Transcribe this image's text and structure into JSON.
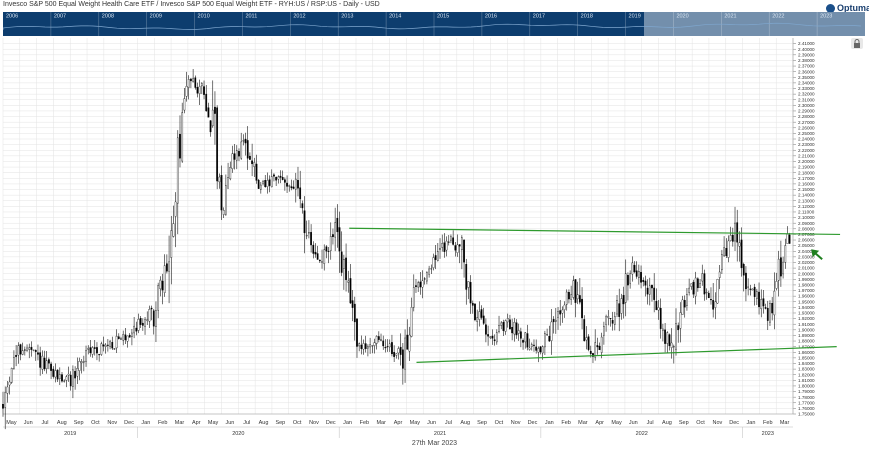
{
  "header": {
    "title": "Invesco S&P 500 Equal Weight Health Care ETF / Invesco S&P 500 Equal Weight ETF - RYH:US / RSP:US - Daily - USD",
    "logo_text": "Optuma"
  },
  "navigator": {
    "years": [
      "2006",
      "2007",
      "2008",
      "2009",
      "2010",
      "2011",
      "2012",
      "2013",
      "2014",
      "2015",
      "2016",
      "2017",
      "2018",
      "2019",
      "2020",
      "2021",
      "2022",
      "2023"
    ],
    "background": "#0d3d6e",
    "highlight": "#c8d4e0"
  },
  "footer": {
    "date_caption": "27th Mar 2023"
  },
  "colors": {
    "candle": "#000000",
    "trendline": "#2e9a2e",
    "arrow": "#1f7f1f",
    "grid": "#e3e3e3"
  },
  "chart_data": {
    "type": "candlestick",
    "title": "Invesco S&P 500 Equal Weight Health Care ETF / Invesco S&P 500 Equal Weight ETF - RYH:US / RSP:US - Daily - USD",
    "ylim": [
      1.75,
      2.42
    ],
    "y_ticks": [
      "2.41000",
      "2.40000",
      "2.39000",
      "2.38000",
      "2.37000",
      "2.36000",
      "2.35000",
      "2.34000",
      "2.33000",
      "2.32000",
      "2.31000",
      "2.30000",
      "2.29000",
      "2.28000",
      "2.27000",
      "2.26000",
      "2.25000",
      "2.24000",
      "2.23000",
      "2.22000",
      "2.21000",
      "2.20000",
      "2.19000",
      "2.18000",
      "2.17000",
      "2.16000",
      "2.15000",
      "2.14000",
      "2.13000",
      "2.12000",
      "2.11000",
      "2.10000",
      "2.09000",
      "2.08000",
      "2.07000",
      "2.06000",
      "2.05000",
      "2.04000",
      "2.03000",
      "2.02000",
      "2.01000",
      "2.00000",
      "1.99000",
      "1.98000",
      "1.97000",
      "1.96000",
      "1.95000",
      "1.94000",
      "1.93000",
      "1.92000",
      "1.91000",
      "1.90000",
      "1.89000",
      "1.88000",
      "1.87000",
      "1.86000",
      "1.85000",
      "1.84000",
      "1.83000",
      "1.82000",
      "1.81000",
      "1.80000",
      "1.79000",
      "1.78000",
      "1.77000",
      "1.76000",
      "1.75000"
    ],
    "x_months": [
      "May",
      "Jun",
      "Jul",
      "Aug",
      "Sep",
      "Oct",
      "Nov",
      "Dec",
      "Jan",
      "Feb",
      "Mar",
      "Apr",
      "May",
      "Jun",
      "Jul",
      "Aug",
      "Sep",
      "Oct",
      "Nov",
      "Dec",
      "Jan",
      "Feb",
      "Mar",
      "Apr",
      "May",
      "Jun",
      "Jul",
      "Aug",
      "Sep",
      "Oct",
      "Nov",
      "Dec",
      "Jan",
      "Feb",
      "Mar",
      "Apr",
      "May",
      "Jun",
      "Jul",
      "Aug",
      "Sep",
      "Oct",
      "Nov",
      "Dec",
      "Jan",
      "Feb",
      "Mar"
    ],
    "x_years": [
      {
        "label": "2019",
        "month_index": 0
      },
      {
        "label": "2020",
        "month_index": 8
      },
      {
        "label": "2021",
        "month_index": 20
      },
      {
        "label": "2022",
        "month_index": 32
      },
      {
        "label": "2023",
        "month_index": 44
      }
    ],
    "price_path": [
      {
        "t": 0,
        "v": 1.76
      },
      {
        "t": 0.5,
        "v": 1.84
      },
      {
        "t": 1.2,
        "v": 1.87
      },
      {
        "t": 2,
        "v": 1.85
      },
      {
        "t": 3,
        "v": 1.82
      },
      {
        "t": 4,
        "v": 1.81
      },
      {
        "t": 5,
        "v": 1.86
      },
      {
        "t": 6,
        "v": 1.87
      },
      {
        "t": 7,
        "v": 1.88
      },
      {
        "t": 8,
        "v": 1.91
      },
      {
        "t": 9,
        "v": 1.93
      },
      {
        "t": 10,
        "v": 2.04
      },
      {
        "t": 10.7,
        "v": 2.3
      },
      {
        "t": 11.3,
        "v": 2.36
      },
      {
        "t": 12,
        "v": 2.31
      },
      {
        "t": 12.5,
        "v": 2.27
      },
      {
        "t": 13,
        "v": 2.12
      },
      {
        "t": 13.5,
        "v": 2.2
      },
      {
        "t": 14.5,
        "v": 2.24
      },
      {
        "t": 15.2,
        "v": 2.15
      },
      {
        "t": 16.5,
        "v": 2.17
      },
      {
        "t": 17.6,
        "v": 2.15
      },
      {
        "t": 18.3,
        "v": 2.04
      },
      {
        "t": 19,
        "v": 2.02
      },
      {
        "t": 19.8,
        "v": 2.08
      },
      {
        "t": 20.5,
        "v": 1.97
      },
      {
        "t": 21.3,
        "v": 1.86
      },
      {
        "t": 22,
        "v": 1.88
      },
      {
        "t": 23,
        "v": 1.87
      },
      {
        "t": 23.8,
        "v": 1.85
      },
      {
        "t": 24.5,
        "v": 1.97
      },
      {
        "t": 25.5,
        "v": 2.02
      },
      {
        "t": 26.5,
        "v": 2.06
      },
      {
        "t": 27.2,
        "v": 2.05
      },
      {
        "t": 27.8,
        "v": 1.95
      },
      {
        "t": 28.5,
        "v": 1.91
      },
      {
        "t": 29.3,
        "v": 1.89
      },
      {
        "t": 30,
        "v": 1.91
      },
      {
        "t": 31,
        "v": 1.89
      },
      {
        "t": 31.8,
        "v": 1.86
      },
      {
        "t": 32.5,
        "v": 1.89
      },
      {
        "t": 33.3,
        "v": 1.95
      },
      {
        "t": 34,
        "v": 1.97
      },
      {
        "t": 34.6,
        "v": 1.89
      },
      {
        "t": 35.1,
        "v": 1.85
      },
      {
        "t": 35.8,
        "v": 1.91
      },
      {
        "t": 36.5,
        "v": 1.93
      },
      {
        "t": 37.5,
        "v": 2.02
      },
      {
        "t": 38.5,
        "v": 1.97
      },
      {
        "t": 39.3,
        "v": 1.89
      },
      {
        "t": 39.8,
        "v": 1.87
      },
      {
        "t": 40.5,
        "v": 1.95
      },
      {
        "t": 41.5,
        "v": 1.99
      },
      {
        "t": 42.2,
        "v": 1.95
      },
      {
        "t": 43,
        "v": 2.04
      },
      {
        "t": 43.6,
        "v": 2.07
      },
      {
        "t": 44.3,
        "v": 1.97
      },
      {
        "t": 45,
        "v": 1.95
      },
      {
        "t": 45.6,
        "v": 1.93
      },
      {
        "t": 46.1,
        "v": 1.99
      },
      {
        "t": 46.6,
        "v": 2.07
      },
      {
        "t": 46.9,
        "v": 2.05
      }
    ],
    "trendlines": [
      {
        "name": "resistance",
        "start": {
          "t": 20.6,
          "v": 2.081
        },
        "end": {
          "t": 49.8,
          "v": 2.07
        }
      },
      {
        "name": "support",
        "start": {
          "t": 24.6,
          "v": 1.842
        },
        "end": {
          "t": 49.6,
          "v": 1.87
        }
      }
    ],
    "annotation": {
      "type": "arrow",
      "t": 48.2,
      "v": 2.04
    }
  }
}
